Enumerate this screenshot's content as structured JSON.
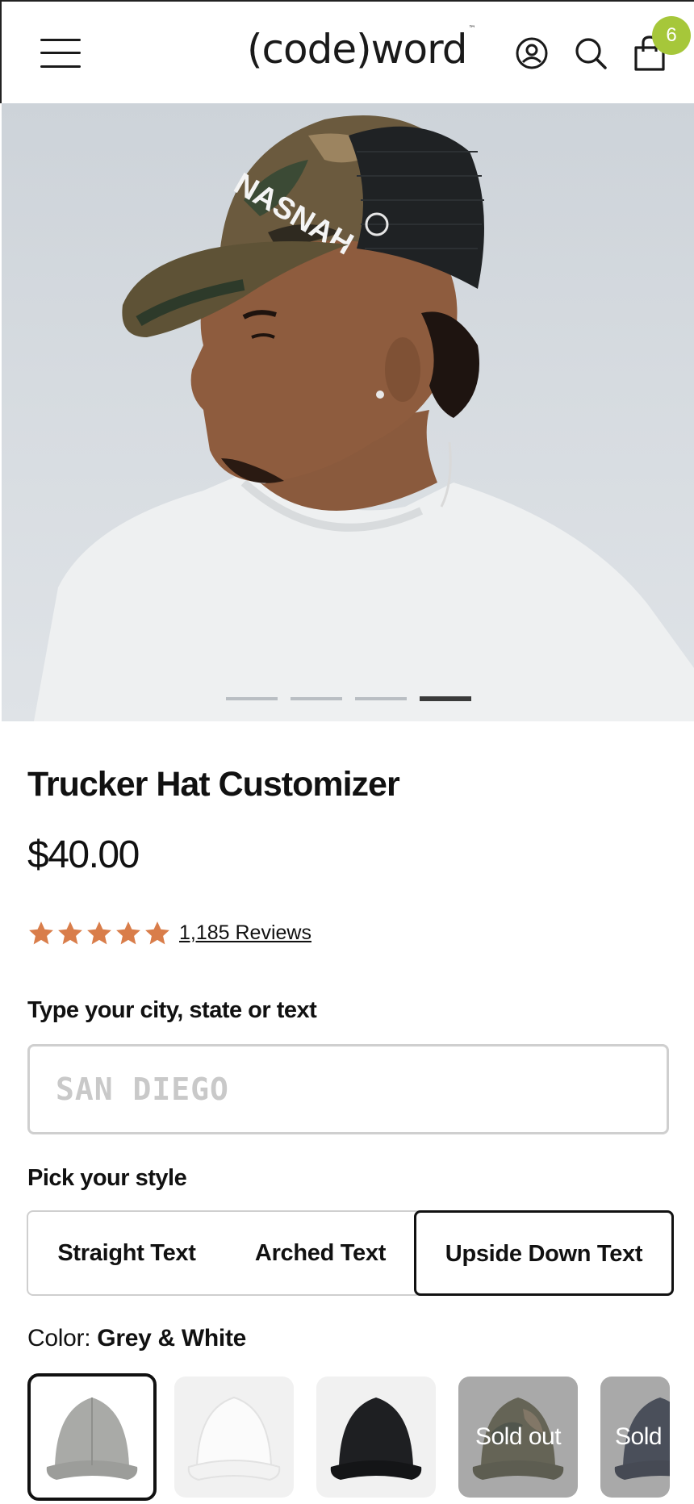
{
  "header": {
    "logo": "(code)word",
    "logo_tm": "™",
    "cart_count": "6"
  },
  "hero": {
    "cap_text": "NASNAH",
    "slide_count": 4,
    "active_slide": 4
  },
  "product": {
    "title": "Trucker Hat Customizer",
    "price": "$40.00",
    "rating": 5,
    "reviews_label": "1,185 Reviews"
  },
  "customizer": {
    "text_label": "Type your city, state or text",
    "text_placeholder": "SAN DIEGO",
    "style_label": "Pick your style",
    "styles": [
      "Straight Text",
      "Arched Text",
      "Upside Down Text"
    ],
    "selected_style": "Upside Down Text",
    "color_label": "Color:",
    "color_value": "Grey & White",
    "swatches": [
      {
        "name": "Grey & White",
        "color": "#a9aaa7",
        "sold_out": false,
        "selected": true
      },
      {
        "name": "White",
        "color": "#f4f4f4",
        "sold_out": false,
        "selected": false
      },
      {
        "name": "Black",
        "color": "#1e1f22",
        "sold_out": false,
        "selected": false
      },
      {
        "name": "Camo",
        "color": "#5c5a3a",
        "sold_out": true,
        "selected": false,
        "sold_label": "Sold out"
      },
      {
        "name": "Navy",
        "color": "#1f2a44",
        "sold_out": true,
        "selected": false,
        "sold_label": "Sold"
      }
    ]
  },
  "colors": {
    "accent_star": "#d97d4a",
    "badge": "#a6c73a",
    "text": "#111111"
  }
}
